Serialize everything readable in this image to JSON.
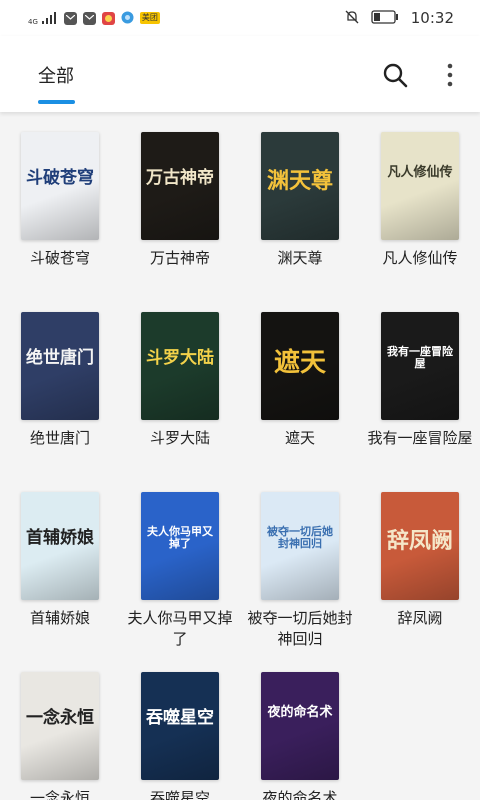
{
  "status_bar": {
    "network": "4G",
    "carrier_badge": "美团",
    "time": "10:32"
  },
  "header": {
    "tab_label": "全部",
    "accent_color": "#1a8fe3"
  },
  "icons": {
    "search": "search-icon",
    "more": "more-vertical-icon"
  },
  "books": [
    {
      "title": "斗破苍穹",
      "cover_text": "斗破苍穹",
      "cover_bg": "#eef0f3",
      "cover_fg": "#1f3e79"
    },
    {
      "title": "万古神帝",
      "cover_text": "万古神帝",
      "cover_bg": "#1e1b17",
      "cover_fg": "#f1e6c8"
    },
    {
      "title": "渊天尊",
      "cover_text": "渊天尊",
      "cover_bg": "#2b3a3a",
      "cover_fg": "#f3c23b"
    },
    {
      "title": "凡人修仙传",
      "cover_text": "凡人修仙传",
      "cover_bg": "#e7e3c9",
      "cover_fg": "#3a3a2a"
    },
    {
      "title": "绝世唐门",
      "cover_text": "绝世唐门",
      "cover_bg": "#2f3e66",
      "cover_fg": "#f4f4f4"
    },
    {
      "title": "斗罗大陆",
      "cover_text": "斗罗大陆",
      "cover_bg": "#1c3b2b",
      "cover_fg": "#f3d24a"
    },
    {
      "title": "遮天",
      "cover_text": "遮天",
      "cover_bg": "#141311",
      "cover_fg": "#f2c13a"
    },
    {
      "title": "我有一座冒险屋",
      "cover_text": "我有一座冒险屋",
      "cover_bg": "#1a1a1a",
      "cover_fg": "#ffffff"
    },
    {
      "title": "首辅娇娘",
      "cover_text": "首辅娇娘",
      "cover_bg": "#dcecf2",
      "cover_fg": "#222222"
    },
    {
      "title": "夫人你马甲又掉了",
      "cover_text": "夫人你马甲又掉了",
      "cover_bg": "#2a63c9",
      "cover_fg": "#ffffff"
    },
    {
      "title": "被夺一切后她封神回归",
      "cover_text": "被夺一切后她封神回归",
      "cover_bg": "#dbe9f5",
      "cover_fg": "#3a6fb0"
    },
    {
      "title": "辞凤阙",
      "cover_text": "辞凤阙",
      "cover_bg": "#c85a3a",
      "cover_fg": "#f5e6c8"
    },
    {
      "title": "一念永恒",
      "cover_text": "一念永恒",
      "cover_bg": "#e9e7e2",
      "cover_fg": "#222222"
    },
    {
      "title": "吞噬星空",
      "cover_text": "吞噬星空",
      "cover_bg": "#153054",
      "cover_fg": "#ffffff"
    },
    {
      "title": "夜的命名术",
      "cover_text": "夜的命名术",
      "cover_bg": "#3a1f5c",
      "cover_fg": "#ffffff"
    }
  ]
}
